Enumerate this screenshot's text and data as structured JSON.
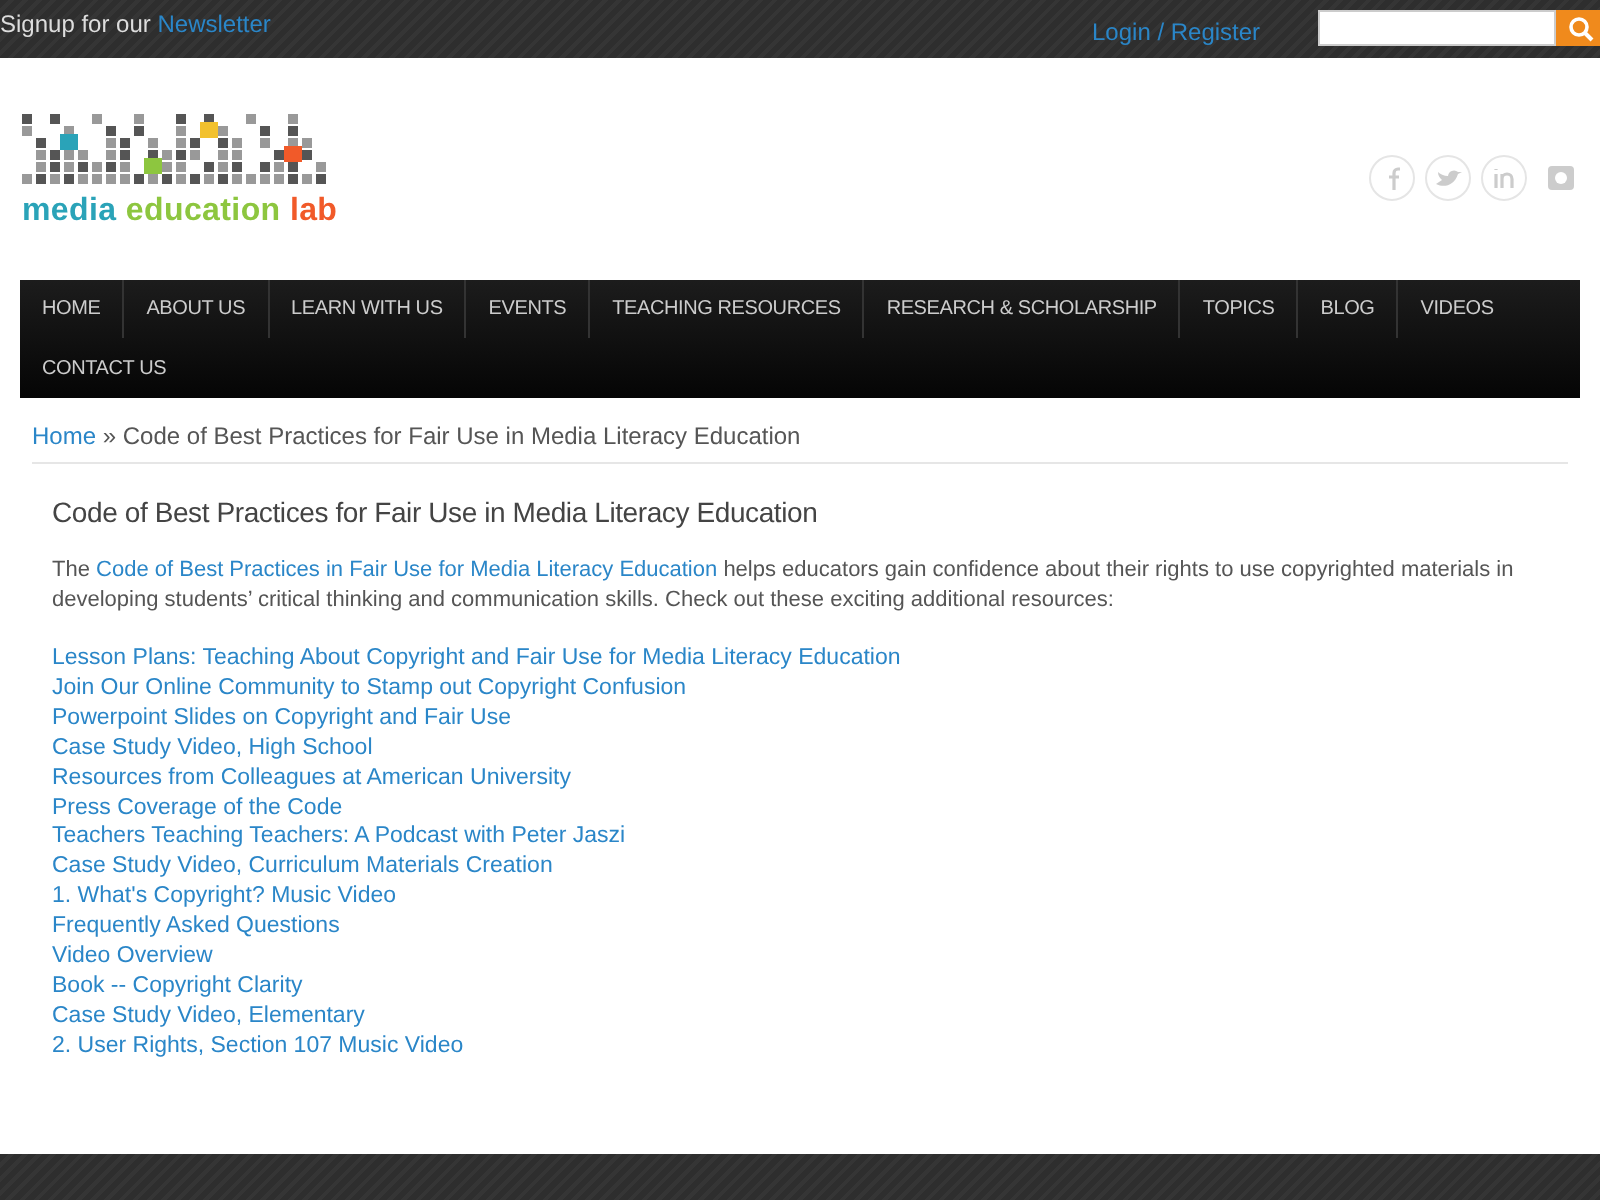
{
  "top_bar": {
    "signup_text": "Signup for our",
    "signup_link": "Newsletter",
    "login": "Login / Register"
  },
  "logo": {
    "words": [
      {
        "text": "media",
        "color": "#2aa3b8"
      },
      {
        "text": "education",
        "color": "#8dc63f"
      },
      {
        "text": "lab",
        "color": "#f15a29"
      }
    ]
  },
  "nav": {
    "items": [
      {
        "label": "HOME"
      },
      {
        "label": "ABOUT US"
      },
      {
        "label": "LEARN WITH US"
      },
      {
        "label": "EVENTS"
      },
      {
        "label": "TEACHING RESOURCES"
      },
      {
        "label": "RESEARCH & SCHOLARSHIP"
      },
      {
        "label": "TOPICS"
      },
      {
        "label": "BLOG"
      },
      {
        "label": "VIDEOS"
      },
      {
        "label": "CONTACT US"
      }
    ]
  },
  "breadcrumb": {
    "home": "Home",
    "separator": "»",
    "current": "Code of Best Practices for Fair Use in Media Literacy Education"
  },
  "content": {
    "title": "Code of Best Practices for Fair Use in Media Literacy Education",
    "intro_before": "The",
    "intro_link": "Code of Best Practices in Fair Use for Media Literacy Education",
    "intro_after": "helps educators gain confidence about their rights to use copyrighted materials in developing students’ critical thinking and communication skills.  Check out these exciting additional resources:",
    "links": [
      "Lesson Plans: Teaching About Copyright and Fair Use for Media Literacy Education",
      "Join Our Online Community to Stamp out Copyright Confusion",
      "Powerpoint Slides on Copyright and Fair Use",
      "Case Study Video, High School",
      "Resources from Colleagues at American University",
      "Press Coverage of the Code",
      "Teachers Teaching Teachers: A Podcast with Peter Jaszi",
      "Case Study Video, Curriculum Materials Creation",
      "1. What's Copyright? Music Video",
      "Frequently Asked Questions",
      "Video Overview",
      "Book -- Copyright Clarity",
      "Case Study Video, Elementary",
      "2. User Rights, Section 107 Music Video"
    ]
  }
}
